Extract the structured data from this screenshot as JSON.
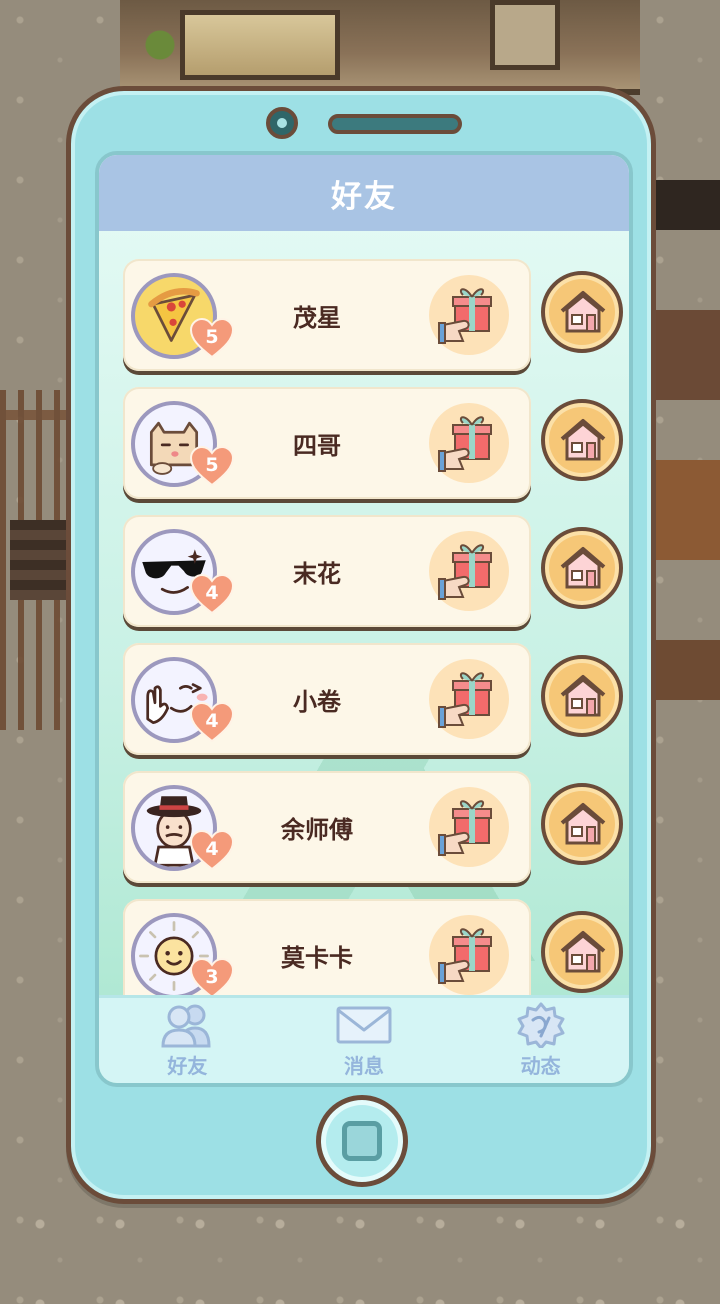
{
  "screen": {
    "title": "好友"
  },
  "friends": [
    {
      "name": "茂星",
      "level": "5",
      "avatar": "pizza-avatar-icon"
    },
    {
      "name": "四哥",
      "level": "5",
      "avatar": "cat-avatar-icon"
    },
    {
      "name": "末花",
      "level": "4",
      "avatar": "sunglasses-avatar-icon"
    },
    {
      "name": "小卷",
      "level": "4",
      "avatar": "wink-avatar-icon"
    },
    {
      "name": "余师傅",
      "level": "4",
      "avatar": "chef-avatar-icon"
    },
    {
      "name": "莫卡卡",
      "level": "3",
      "avatar": "sun-avatar-icon"
    }
  ],
  "tabs": [
    {
      "label": "好友",
      "icon": "friends-icon"
    },
    {
      "label": "消息",
      "icon": "mail-icon"
    },
    {
      "label": "动态",
      "icon": "moments-icon"
    }
  ],
  "colors": {
    "phone_body": "#9de0e5",
    "phone_outline": "#6b4c3a",
    "header": "#a9c4e4",
    "card": "#fdf7e8",
    "heart": "#f49a7a",
    "tab_label": "#94b5dc",
    "home_button": "#f6c777"
  }
}
